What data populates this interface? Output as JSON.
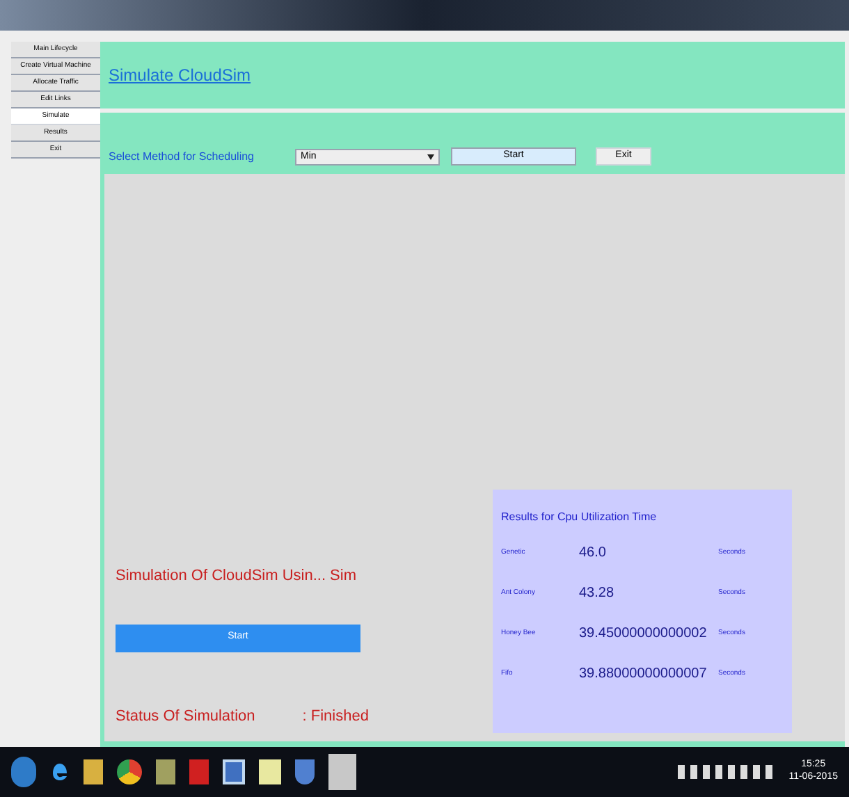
{
  "sidebar": {
    "items": [
      {
        "label": "Main Lifecycle",
        "selected": false
      },
      {
        "label": "Create Virtual Machine",
        "selected": false
      },
      {
        "label": "Allocate Traffic",
        "selected": false
      },
      {
        "label": "Edit Links",
        "selected": false
      },
      {
        "label": "Simulate",
        "selected": true
      },
      {
        "label": "Results",
        "selected": false
      },
      {
        "label": "Exit",
        "selected": false
      }
    ]
  },
  "header": {
    "title": "Simulate CloudSim"
  },
  "controls": {
    "label": "Select Method for Scheduling",
    "dropdown": "Min",
    "start_button": "Start",
    "exit_button": "Exit"
  },
  "simulation": {
    "title": "Simulation Of CloudSim Usin... Sim",
    "button": "Start",
    "status_label": "Status Of Simulation",
    "status_value": ": Finished"
  },
  "results": {
    "title": "Results for Cpu Utilization Time",
    "rows": [
      {
        "name": "Genetic",
        "value": "46.0",
        "unit": "Seconds"
      },
      {
        "name": "Ant Colony",
        "value": "43.28",
        "unit": "Seconds"
      },
      {
        "name": "Honey Bee",
        "value": "39.45000000000002",
        "unit": "Seconds"
      },
      {
        "name": "Fifo",
        "value": "39.88000000000007",
        "unit": "Seconds"
      }
    ]
  },
  "taskbar": {
    "time": "15:25",
    "date": "11-06-2015"
  }
}
